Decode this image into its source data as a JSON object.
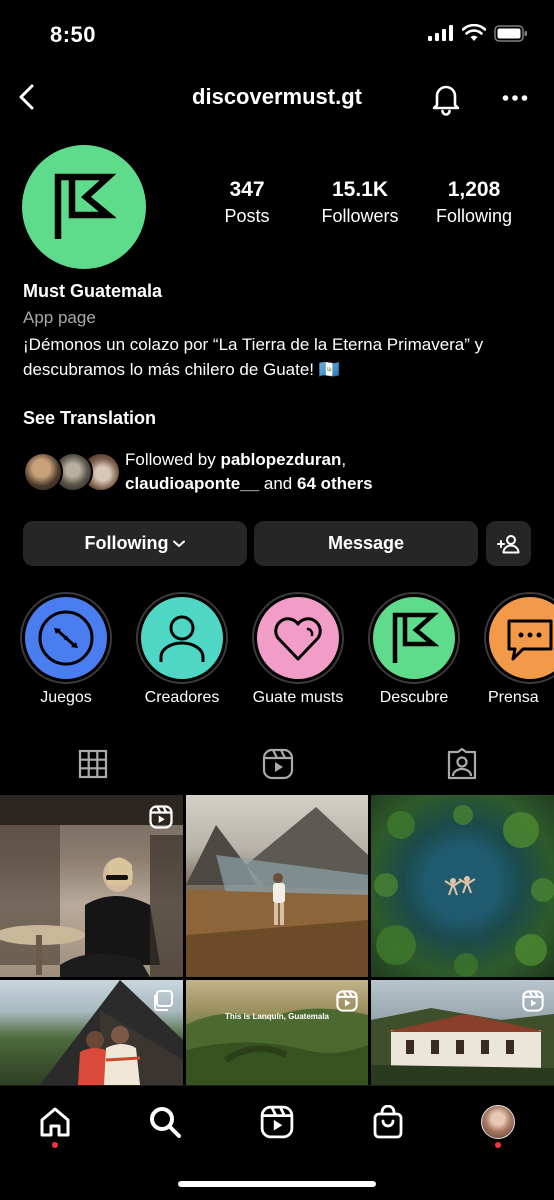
{
  "status_bar": {
    "time": "8:50"
  },
  "header": {
    "username": "discovermust.gt"
  },
  "profile": {
    "stats": [
      {
        "count": "347",
        "label": "Posts"
      },
      {
        "count": "15.1K",
        "label": "Followers"
      },
      {
        "count": "1,208",
        "label": "Following"
      }
    ],
    "name": "Must Guatemala",
    "category": "App page",
    "bio": "¡Démonos un colazo por “La Tierra de la Eterna Primavera” y descubramos lo más chilero de Guate! 🇬🇹",
    "see_translation": "See Translation",
    "followed_by": {
      "prefix": "Followed by",
      "user1": "pablopezduran",
      "comma": ",",
      "user2": "claudioaponte__",
      "and": "and",
      "others": "64 others"
    }
  },
  "buttons": {
    "following": "Following",
    "message": "Message"
  },
  "highlights": [
    {
      "label": "Juegos",
      "color": "#4a7df0"
    },
    {
      "label": "Creadores",
      "color": "#4fd6c4"
    },
    {
      "label": "Guate musts",
      "color": "#f19dc8"
    },
    {
      "label": "Descubre",
      "color": "#5fdb8c"
    },
    {
      "label": "Prensa",
      "color": "#f39a4a"
    }
  ],
  "colors": {
    "brand_green": "#5fdb8c",
    "notification_red": "#ff3040",
    "button_bg": "#262626"
  },
  "grid_posts": [
    {
      "id": "cafe-woman-reel",
      "type": "reel",
      "overlay_text": ""
    },
    {
      "id": "mountain-lake-hiker",
      "type": "photo",
      "overlay_text": ""
    },
    {
      "id": "pond-aerial-swimmers",
      "type": "photo",
      "overlay_text": ""
    },
    {
      "id": "cabin-couple",
      "type": "carousel",
      "overlay_text": ""
    },
    {
      "id": "lanquin-valley-reel",
      "type": "reel",
      "overlay_text": "This is Lanquín, Guatemala"
    },
    {
      "id": "colonial-building-reel",
      "type": "reel",
      "overlay_text": ""
    }
  ]
}
